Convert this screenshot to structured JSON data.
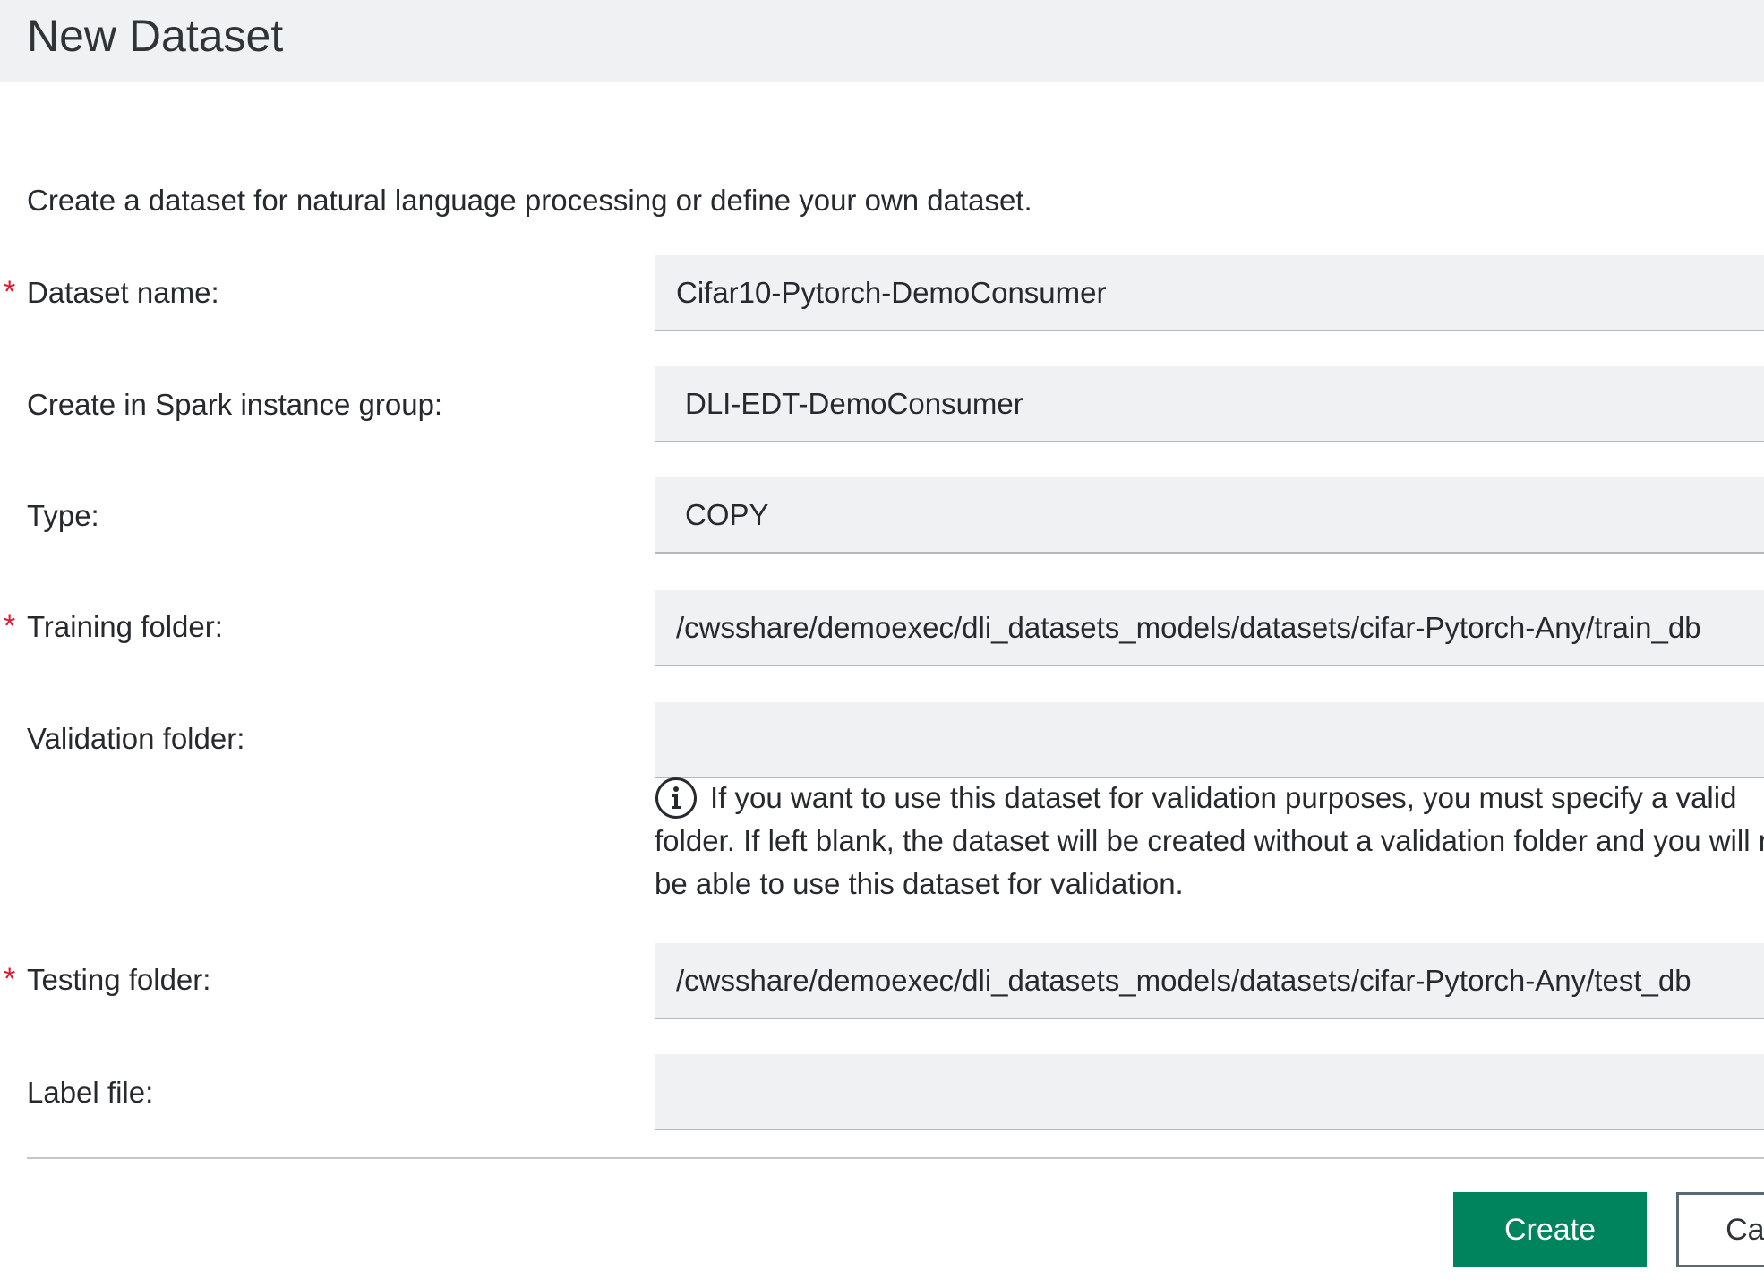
{
  "dialog": {
    "title": "New Dataset",
    "description": "Create a dataset for natural language processing or define your own dataset."
  },
  "form": {
    "dataset_name": {
      "label": "Dataset name:",
      "required_marker": "*",
      "value": "Cifar10-Pytorch-DemoConsumer"
    },
    "instance_group": {
      "label": "Create in Spark instance group:",
      "value": "DLI-EDT-DemoConsumer"
    },
    "type": {
      "label": "Type:",
      "value": "COPY"
    },
    "training_folder": {
      "label": "Training folder:",
      "required_marker": "*",
      "value": "/cwsshare/demoexec/dli_datasets_models/datasets/cifar-Pytorch-Any/train_db"
    },
    "validation_folder": {
      "label": "Validation folder:",
      "value": "",
      "info_icon": "info-circle-icon",
      "info_lines": [
        "If you want to use this dataset for validation purposes, you must specify a valid",
        "folder. If left blank, the dataset will be created without a validation folder and you will not",
        "be able to use this dataset for validation."
      ]
    },
    "testing_folder": {
      "label": "Testing folder:",
      "required_marker": "*",
      "value": "/cwsshare/demoexec/dli_datasets_models/datasets/cifar-Pytorch-Any/test_db"
    },
    "label_file": {
      "label": "Label file:",
      "value": ""
    }
  },
  "actions": {
    "create_label": "Create",
    "cancel_label": "Cancel"
  },
  "colors": {
    "primary_button": "#00845e",
    "required_marker": "#e0182d",
    "header_background": "#f0f1f2",
    "input_background": "#f0f1f2"
  }
}
